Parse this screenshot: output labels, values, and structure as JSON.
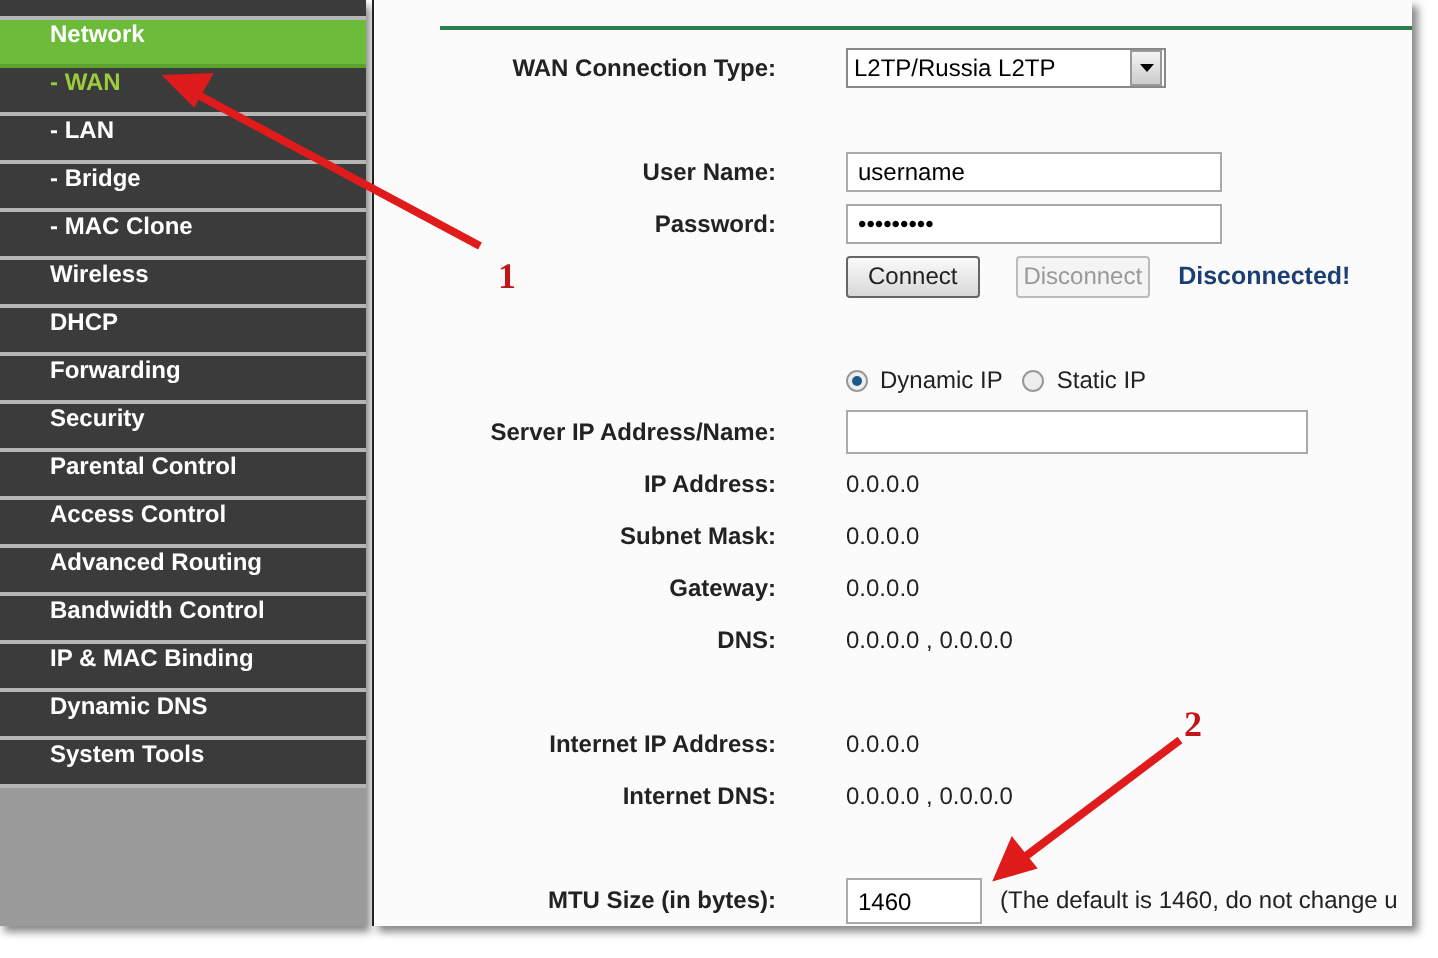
{
  "sidebar": {
    "items": [
      {
        "label": "Network",
        "kind": "section",
        "selected": true
      },
      {
        "label": "- WAN",
        "kind": "sub",
        "selected": true
      },
      {
        "label": "- LAN",
        "kind": "sub",
        "selected": false
      },
      {
        "label": "- Bridge",
        "kind": "sub",
        "selected": false
      },
      {
        "label": "- MAC Clone",
        "kind": "sub",
        "selected": false
      },
      {
        "label": "Wireless",
        "kind": "section",
        "selected": false
      },
      {
        "label": "DHCP",
        "kind": "section",
        "selected": false
      },
      {
        "label": "Forwarding",
        "kind": "section",
        "selected": false
      },
      {
        "label": "Security",
        "kind": "section",
        "selected": false
      },
      {
        "label": "Parental Control",
        "kind": "section",
        "selected": false
      },
      {
        "label": "Access Control",
        "kind": "section",
        "selected": false
      },
      {
        "label": "Advanced Routing",
        "kind": "section",
        "selected": false
      },
      {
        "label": "Bandwidth Control",
        "kind": "section",
        "selected": false
      },
      {
        "label": "IP & MAC Binding",
        "kind": "section",
        "selected": false
      },
      {
        "label": "Dynamic DNS",
        "kind": "section",
        "selected": false
      },
      {
        "label": "System Tools",
        "kind": "section",
        "selected": false
      }
    ]
  },
  "form": {
    "connection_type": {
      "label": "WAN Connection Type:",
      "value": "L2TP/Russia L2TP"
    },
    "user_name": {
      "label": "User Name:",
      "value": "username"
    },
    "password": {
      "label": "Password:",
      "value": "•••••••••"
    },
    "buttons": [
      {
        "label": "Connect",
        "disabled": false
      },
      {
        "label": "Disconnect",
        "disabled": true
      }
    ],
    "status": "Disconnected!",
    "ip_mode": [
      {
        "label": "Dynamic IP",
        "selected": true
      },
      {
        "label": "Static IP",
        "selected": false
      }
    ],
    "server": {
      "label": "Server IP Address/Name:"
    },
    "info": [
      {
        "label": "IP Address:",
        "value": "0.0.0.0"
      },
      {
        "label": "Subnet Mask:",
        "value": "0.0.0.0"
      },
      {
        "label": "Gateway:",
        "value": "0.0.0.0"
      },
      {
        "label": "DNS:",
        "value": "0.0.0.0 , 0.0.0.0"
      }
    ],
    "internet": [
      {
        "label": "Internet IP Address:",
        "value": "0.0.0.0"
      },
      {
        "label": "Internet DNS:",
        "value": "0.0.0.0 , 0.0.0.0"
      }
    ],
    "mtu": {
      "label": "MTU Size (in bytes):",
      "value": "1460",
      "note": "(The default is 1460, do not change u"
    }
  },
  "annotations": [
    {
      "text": "1"
    },
    {
      "text": "2"
    }
  ]
}
